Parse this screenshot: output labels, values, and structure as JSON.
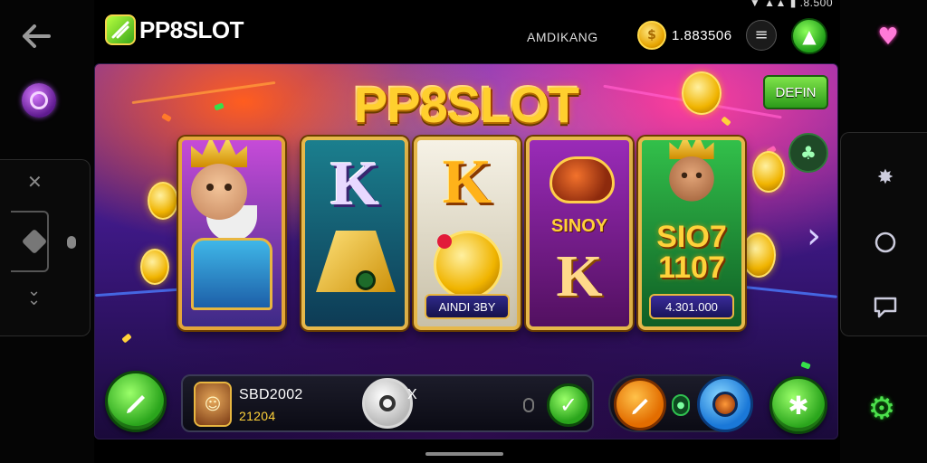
{
  "status_bar": {
    "text": "▼ ▲▲ ▮ .8.500"
  },
  "header": {
    "brand": "PP8SLOT",
    "player_name": "AMDIKANG",
    "balance": "1.883506",
    "balance_icon": "coin-icon",
    "menu_icon": "menu-lines-icon",
    "upgrade_icon": "triangle-up-icon"
  },
  "stage": {
    "title": "PP8SLOT",
    "demo_button": "DEFIN",
    "reels": [
      {
        "symbol": "king-character",
        "label": ""
      },
      {
        "symbol": "K",
        "label": ""
      },
      {
        "symbol": "K",
        "label": "AINDI 3BY"
      },
      {
        "symbol": "K",
        "top_text": "SINOY",
        "label": ""
      },
      {
        "symbol": "king-character",
        "top_text": "SIO7\n1107",
        "label": "4.301.000"
      }
    ]
  },
  "controls": {
    "stat_primary": "SBD2002",
    "stat_secondary": "21204",
    "stat_suffix": "X"
  },
  "colors": {
    "brand_green": "#2aa51c",
    "gold": "#ffcf2e",
    "stage_purple": "#3d1883"
  }
}
